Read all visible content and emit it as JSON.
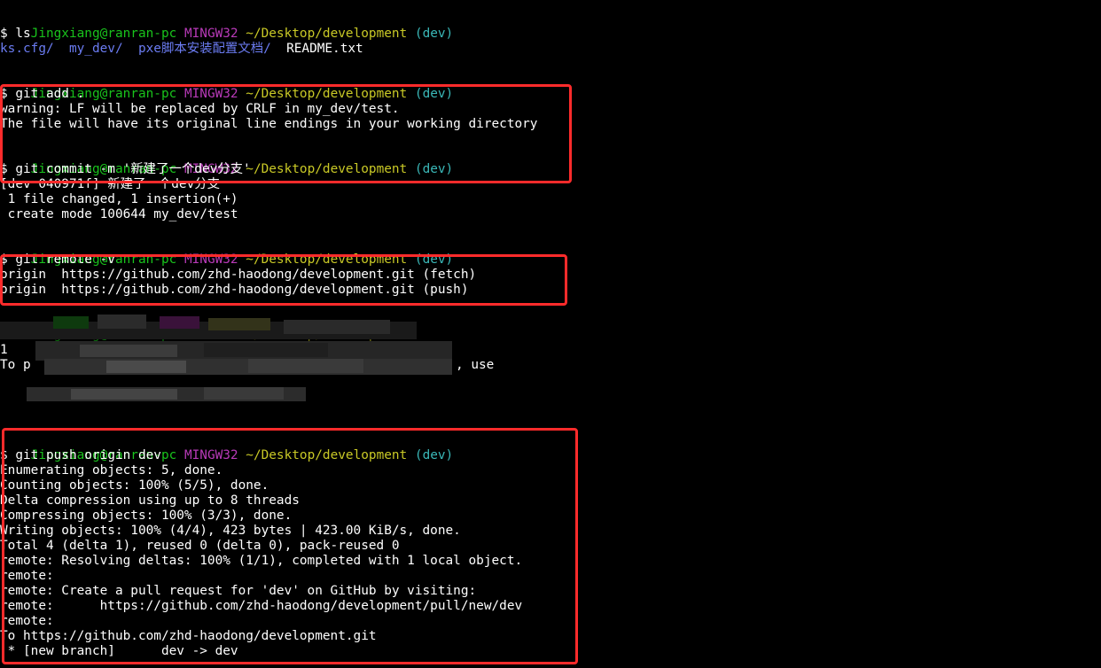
{
  "prompt": {
    "user_host": "Jingxiang@ranran-pc",
    "shell": "MINGW32",
    "path": "~/Desktop/development",
    "branch": "(dev)"
  },
  "commands": {
    "ls": "$ ls",
    "git_add": "$ git add .",
    "git_commit": "$ git commit -m '新建了一个dev分支'",
    "git_remote": "$ git remote -v",
    "git_push": "$ git push origin dev"
  },
  "ls_output": {
    "item1": "ks.cfg/",
    "item2": "my_dev/",
    "item3": "pxe脚本安装配置文档/",
    "item4": "README.txt"
  },
  "add_output": {
    "line1": "warning: LF will be replaced by CRLF in my_dev/test.",
    "line2": "The file will have its original line endings in your working directory"
  },
  "commit_output": {
    "line1": "[dev 040971f] 新建了一个dev分支",
    "line2": " 1 file changed, 1 insertion(+)",
    "line3": " create mode 100644 my_dev/test"
  },
  "remote_output": {
    "line1": "origin  https://github.com/zhd-haodong/development.git (fetch)",
    "line2": "origin  https://github.com/zhd-haodong/development.git (push)"
  },
  "obscured_output": {
    "line1_start": "1",
    "line2_start": "To p",
    "line2_end": ", use"
  },
  "push_output": [
    "Enumerating objects: 5, done.",
    "Counting objects: 100% (5/5), done.",
    "Delta compression using up to 8 threads",
    "Compressing objects: 100% (3/3), done.",
    "Writing objects: 100% (4/4), 423 bytes | 423.00 KiB/s, done.",
    "Total 4 (delta 1), reused 0 (delta 0), pack-reused 0",
    "remote: Resolving deltas: 100% (1/1), completed with 1 local object.",
    "remote:",
    "remote: Create a pull request for 'dev' on GitHub by visiting:",
    "remote:      https://github.com/zhd-haodong/development/pull/new/dev",
    "remote:",
    "To https://github.com/zhd-haodong/development.git",
    " * [new branch]      dev -> dev"
  ],
  "colors": {
    "background": "#000000",
    "user": "#19c31c",
    "host": "#b83ab8",
    "path": "#c9c926",
    "branch": "#3ab8b8",
    "directory": "#6b7cf2",
    "highlight_border": "#ff2b2b"
  }
}
